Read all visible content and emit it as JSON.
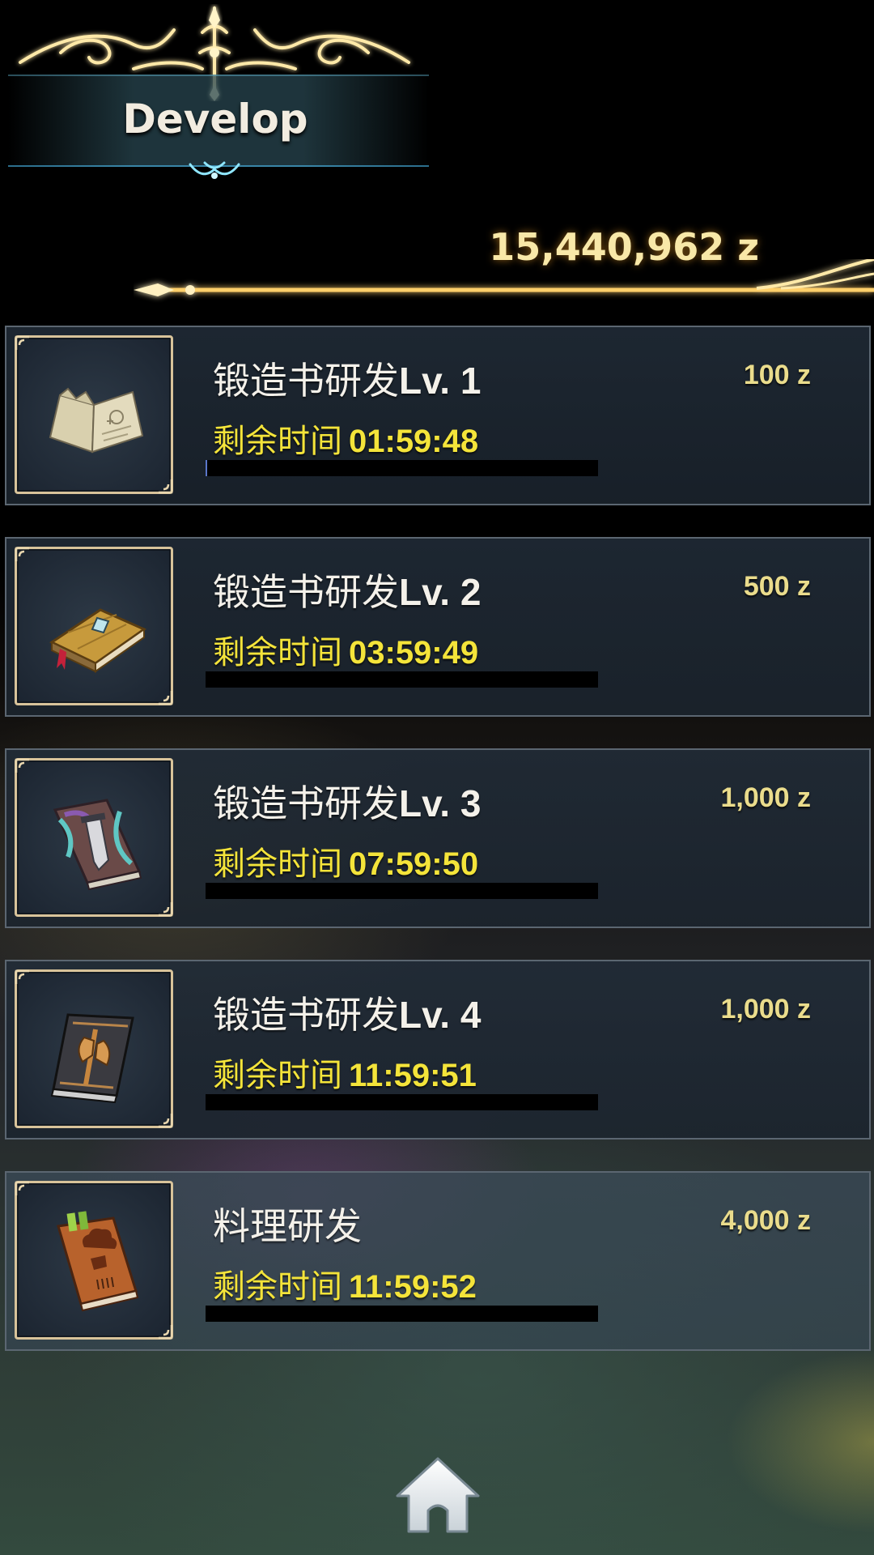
{
  "header": {
    "title": "Develop"
  },
  "currency": {
    "amount": "15,440,962 z"
  },
  "items": [
    {
      "name": "锻造书研发",
      "level": "Lv. 1",
      "cost": "100 z",
      "time_label": "剩余时间",
      "time": "01:59:48",
      "progress": 0.005,
      "icon": "tattered-book-icon"
    },
    {
      "name": "锻造书研发",
      "level": "Lv. 2",
      "cost": "500 z",
      "time_label": "剩余时间",
      "time": "03:59:49",
      "progress": 0,
      "icon": "wooden-book-icon"
    },
    {
      "name": "锻造书研发",
      "level": "Lv. 3",
      "cost": "1,000 z",
      "time_label": "剩余时间",
      "time": "07:59:50",
      "progress": 0,
      "icon": "sword-book-icon"
    },
    {
      "name": "锻造书研发",
      "level": "Lv. 4",
      "cost": "1,000 z",
      "time_label": "剩余时间",
      "time": "11:59:51",
      "progress": 0,
      "icon": "axe-book-icon"
    },
    {
      "name": "料理研发",
      "level": "",
      "cost": "4,000 z",
      "time_label": "剩余时间",
      "time": "11:59:52",
      "progress": 0,
      "icon": "cooking-book-icon"
    }
  ],
  "nav": {
    "home_icon": "home-icon"
  },
  "colors": {
    "timer": "#f4e43a",
    "cost": "#eadc8c",
    "frame": "#d8c39a",
    "glow": "#ffb43a"
  }
}
